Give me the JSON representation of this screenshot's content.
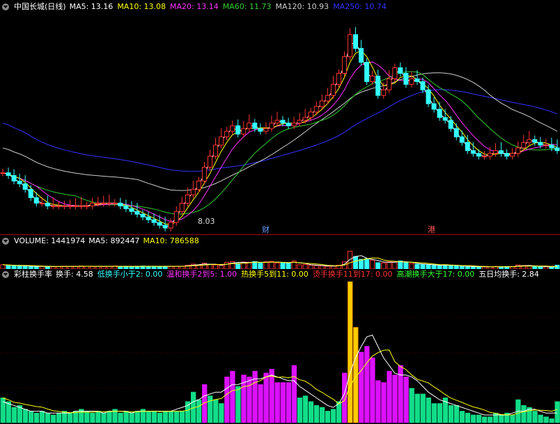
{
  "price_panel": {
    "title": "中国长城(日线)",
    "ma": [
      {
        "label": "MA5: 13.16",
        "color": "#ffffff"
      },
      {
        "label": "MA10: 13.08",
        "color": "#ffff00"
      },
      {
        "label": "MA20: 13.14",
        "color": "#ff33ff"
      },
      {
        "label": "MA60: 11.73",
        "color": "#33cc33"
      },
      {
        "label": "MA120: 10.93",
        "color": "#cccccc"
      },
      {
        "label": "MA250: 10.74",
        "color": "#3333ff"
      }
    ],
    "low_marker": "8.03",
    "tag_cai": "财",
    "tag_gang": "港"
  },
  "volume_panel": {
    "title": "VOLUME: 1441974",
    "ma5": "MA5: 892447",
    "ma10": "MA10: 786588"
  },
  "turnover_panel": {
    "title": "彩柱换手率",
    "items": [
      {
        "label": "换手: 4.58",
        "color": "#ffffff"
      },
      {
        "label": "低换手小于2: 0.00",
        "color": "#33ffff"
      },
      {
        "label": "温和换手2到5: 1.00",
        "color": "#ff33ff"
      },
      {
        "label": "热换手5到11: 0.00",
        "color": "#ffff00"
      },
      {
        "label": "烫手换手11到17: 0.00",
        "color": "#ff3333"
      },
      {
        "label": "高潮换手大于17: 0.00",
        "color": "#33ff33"
      },
      {
        "label": "五日均换手: 2.84",
        "color": "#ffffff"
      }
    ]
  },
  "chart_data": {
    "type": "bar",
    "title": "彩柱换手率",
    "categories": [],
    "series": [
      {
        "name": "换手",
        "values": [
          1.3,
          1.1,
          0.8,
          0.9,
          0.7,
          0.6,
          0.5,
          0.6,
          0.5,
          0.4,
          0.5,
          0.6,
          0.5,
          0.6,
          0.7,
          0.6,
          0.5,
          0.6,
          0.5,
          0.6,
          0.7,
          0.5,
          0.6,
          0.5,
          0.6,
          0.7,
          0.6,
          0.6,
          0.5,
          0.6,
          0.6,
          0.6,
          0.6,
          1.1,
          1.6,
          1.2,
          2.0,
          1.4,
          1.2,
          1.0,
          2.4,
          2.7,
          1.9,
          2.5,
          2.4,
          2.7,
          2.0,
          2.6,
          2.8,
          2.1,
          2.1,
          2.1,
          3.0,
          1.3,
          1.4,
          1.1,
          0.9,
          0.8,
          0.6,
          0.7,
          1.1,
          2.6,
          7.4,
          5.0,
          3.7,
          4.0,
          3.4,
          2.2,
          2.1,
          2.7,
          2.5,
          3.0,
          2.4,
          1.8,
          1.5,
          1.5,
          1.3,
          1.0,
          1.0,
          1.3,
          0.9,
          0.9,
          0.6,
          0.5,
          0.4,
          0.4,
          0.3,
          0.3,
          0.5,
          0.4,
          0.5,
          0.4,
          1.2,
          0.9,
          0.8,
          0.6,
          0.4,
          0.3,
          0.2,
          1.1
        ]
      },
      {
        "name": "五日均换手",
        "values": [
          1.1,
          1.0,
          0.9,
          0.8,
          0.7,
          0.6,
          0.6,
          0.6,
          0.5,
          0.5,
          0.5,
          0.5,
          0.5,
          0.6,
          0.6,
          0.6,
          0.6,
          0.6,
          0.5,
          0.6,
          0.6,
          0.6,
          0.6,
          0.5,
          0.6,
          0.6,
          0.6,
          0.6,
          0.6,
          0.6,
          0.6,
          0.7,
          0.8,
          0.9,
          1.1,
          1.2,
          1.4,
          1.5,
          1.6,
          1.6,
          1.8,
          2.0,
          2.0,
          2.1,
          2.2,
          2.3,
          2.3,
          2.4,
          2.5,
          2.4,
          2.3,
          2.2,
          2.2,
          1.9,
          1.7,
          1.5,
          1.3,
          1.1,
          0.9,
          0.8,
          1.0,
          1.5,
          2.6,
          3.4,
          4.0,
          4.5,
          4.6,
          4.0,
          3.4,
          3.0,
          2.6,
          2.5,
          2.5,
          2.4,
          2.2,
          1.9,
          1.6,
          1.4,
          1.2,
          1.1,
          1.0,
          0.9,
          0.8,
          0.7,
          0.6,
          0.5,
          0.4,
          0.4,
          0.4,
          0.4,
          0.4,
          0.5,
          0.6,
          0.6,
          0.7,
          0.7,
          0.6,
          0.5,
          0.5,
          0.5
        ]
      }
    ],
    "thresholds": [
      2,
      5,
      11,
      17
    ],
    "colors": {
      "low": "#11dd88",
      "mild": "#dd11ff",
      "hot": "#ffcc00",
      "warm_edge": "#ff9900",
      "avg_line": "#ffffff",
      "ma10_line": "#ffff00"
    },
    "price": {
      "type": "candlestick",
      "close": [
        10.0,
        9.9,
        9.7,
        9.6,
        9.4,
        9.1,
        8.9,
        8.9,
        8.8,
        8.8,
        8.8,
        8.8,
        8.8,
        8.8,
        8.8,
        8.8,
        8.9,
        8.9,
        8.9,
        8.9,
        8.9,
        8.8,
        8.7,
        8.6,
        8.5,
        8.4,
        8.3,
        8.2,
        8.1,
        8.0,
        8.2,
        8.6,
        8.9,
        9.2,
        9.4,
        9.7,
        10.2,
        10.6,
        11.0,
        11.3,
        11.5,
        11.7,
        11.4,
        11.6,
        11.8,
        11.6,
        11.5,
        11.6,
        11.8,
        11.9,
        11.8,
        11.7,
        11.8,
        11.9,
        12.0,
        12.2,
        12.4,
        12.6,
        12.8,
        13.2,
        13.6,
        14.2,
        15.0,
        14.5,
        14.0,
        13.3,
        13.5,
        12.8,
        13.0,
        13.4,
        13.8,
        13.6,
        13.2,
        13.4,
        13.3,
        13.0,
        12.5,
        12.3,
        12.0,
        11.9,
        11.6,
        11.3,
        11.1,
        10.8,
        10.7,
        10.6,
        10.6,
        10.7,
        10.8,
        10.7,
        10.6,
        10.7,
        10.9,
        11.1,
        11.2,
        11.1,
        11.0,
        11.0,
        10.9,
        10.8
      ],
      "y_range": [
        7.8,
        15.8
      ],
      "ma_series": {
        "MA250": "#3333ff",
        "MA120": "#cccccc",
        "MA60": "#33cc33",
        "MA20": "#ff33ff",
        "MA10": "#ffff00",
        "MA5": "#ffffff"
      }
    },
    "volume": {
      "ma5_color": "#ffffff",
      "ma10_color": "#ffff00"
    }
  }
}
